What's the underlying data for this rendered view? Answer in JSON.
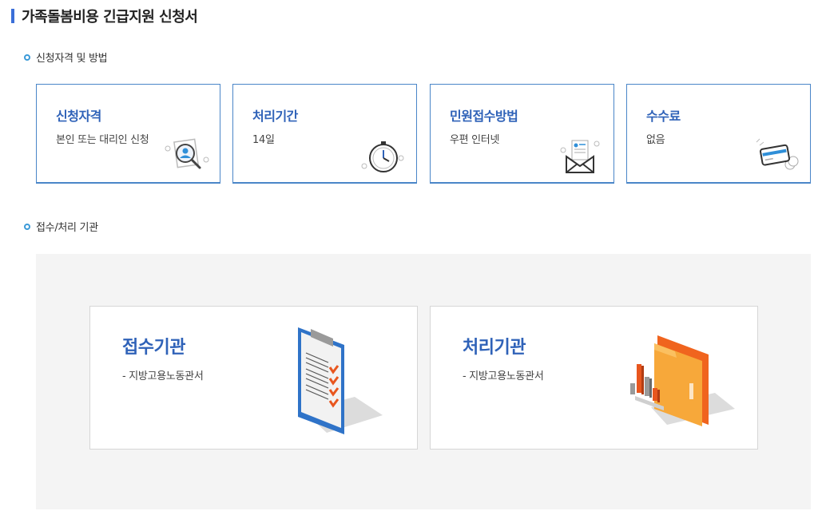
{
  "page": {
    "title": "가족돌봄비용 긴급지원 신청서"
  },
  "sections": {
    "eligibility": "신청자격 및 방법",
    "agencies": "접수/처리 기관"
  },
  "info_cards": [
    {
      "title": "신청자격",
      "desc": "본인 또는 대리인 신청",
      "icon": "person-search-icon"
    },
    {
      "title": "처리기간",
      "desc": "14일",
      "icon": "clock-icon"
    },
    {
      "title": "민원접수방법",
      "desc": "우편  인터넷",
      "icon": "envelope-document-icon"
    },
    {
      "title": "수수료",
      "desc": "없음",
      "icon": "card-coin-icon"
    }
  ],
  "agency_cards": [
    {
      "title": "접수기관",
      "desc": "-  지방고용노동관서",
      "icon": "clipboard-checklist-icon"
    },
    {
      "title": "처리기관",
      "desc": "-  지방고용노동관서",
      "icon": "folder-chart-icon"
    }
  ],
  "colors": {
    "accent": "#2f62b8",
    "border": "#4a86c8",
    "bullet": "#3b9ad8",
    "panel": "#f4f4f4"
  }
}
